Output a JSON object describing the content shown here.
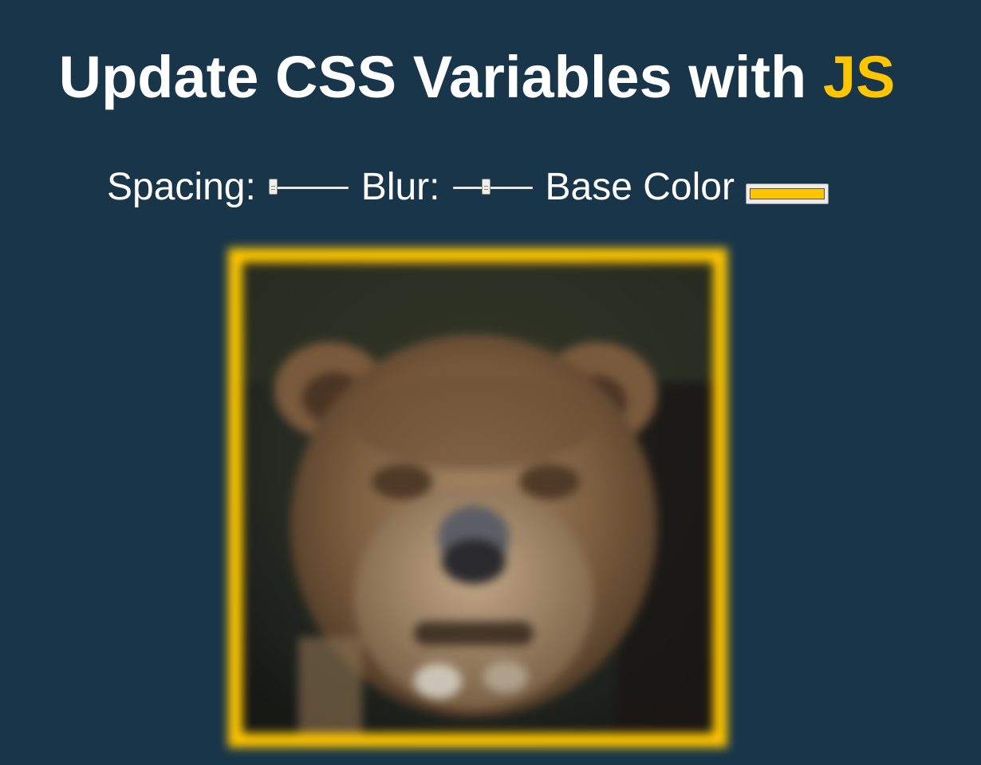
{
  "header": {
    "title_prefix": "Update CSS Variables with",
    "title_highlight": "JS"
  },
  "controls": {
    "spacing_label": "Spacing:",
    "spacing_value": 10,
    "spacing_min": 10,
    "spacing_max": 200,
    "blur_label": "Blur:",
    "blur_value": 10,
    "blur_min": 0,
    "blur_max": 25,
    "base_color_label": "Base Color",
    "base_color_value": "#ffc600"
  },
  "colors": {
    "background": "#193549",
    "accent": "#ffc600"
  },
  "image": {
    "subject": "lioness-photo"
  }
}
